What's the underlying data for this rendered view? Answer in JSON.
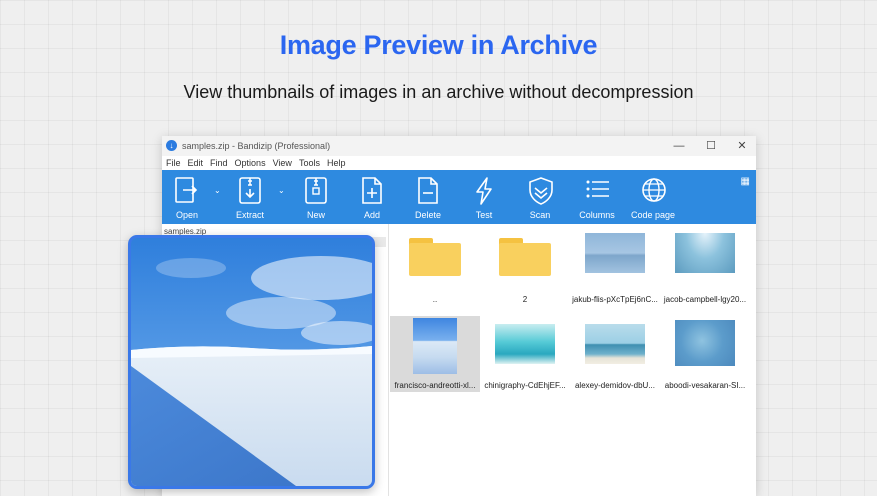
{
  "header": {
    "title": "Image Preview in Archive",
    "subtitle": "View thumbnails of images in an archive without decompression"
  },
  "window": {
    "title": "samples.zip - Bandizip (Professional)",
    "controls": {
      "minimize": "—",
      "maximize": "☐",
      "close": "✕"
    }
  },
  "menu": [
    "File",
    "Edit",
    "Find",
    "Options",
    "View",
    "Tools",
    "Help"
  ],
  "toolbar": {
    "open": "Open",
    "extract": "Extract",
    "new": "New",
    "add": "Add",
    "delete": "Delete",
    "test": "Test",
    "scan": "Scan",
    "columns": "Columns",
    "codepage": "Code page"
  },
  "tree": {
    "root": "samples.zip"
  },
  "files": [
    {
      "label": "..",
      "kind": "folder"
    },
    {
      "label": "2",
      "kind": "folder"
    },
    {
      "label": "jakub-flis-pXcTpEj6nC...",
      "kind": "image"
    },
    {
      "label": "jacob-campbell-lgy20...",
      "kind": "image"
    },
    {
      "label": "francisco-andreotti-xl...",
      "kind": "image",
      "selected": true
    },
    {
      "label": "chinigraphy-CdEhjEF...",
      "kind": "image"
    },
    {
      "label": "alexey-demidov-dbU...",
      "kind": "image"
    },
    {
      "label": "aboodi-vesakaran-SI...",
      "kind": "image"
    }
  ],
  "colors": {
    "accent": "#2b66f0",
    "toolbar": "#2e8ae0",
    "preview_border": "#3a78e8"
  }
}
